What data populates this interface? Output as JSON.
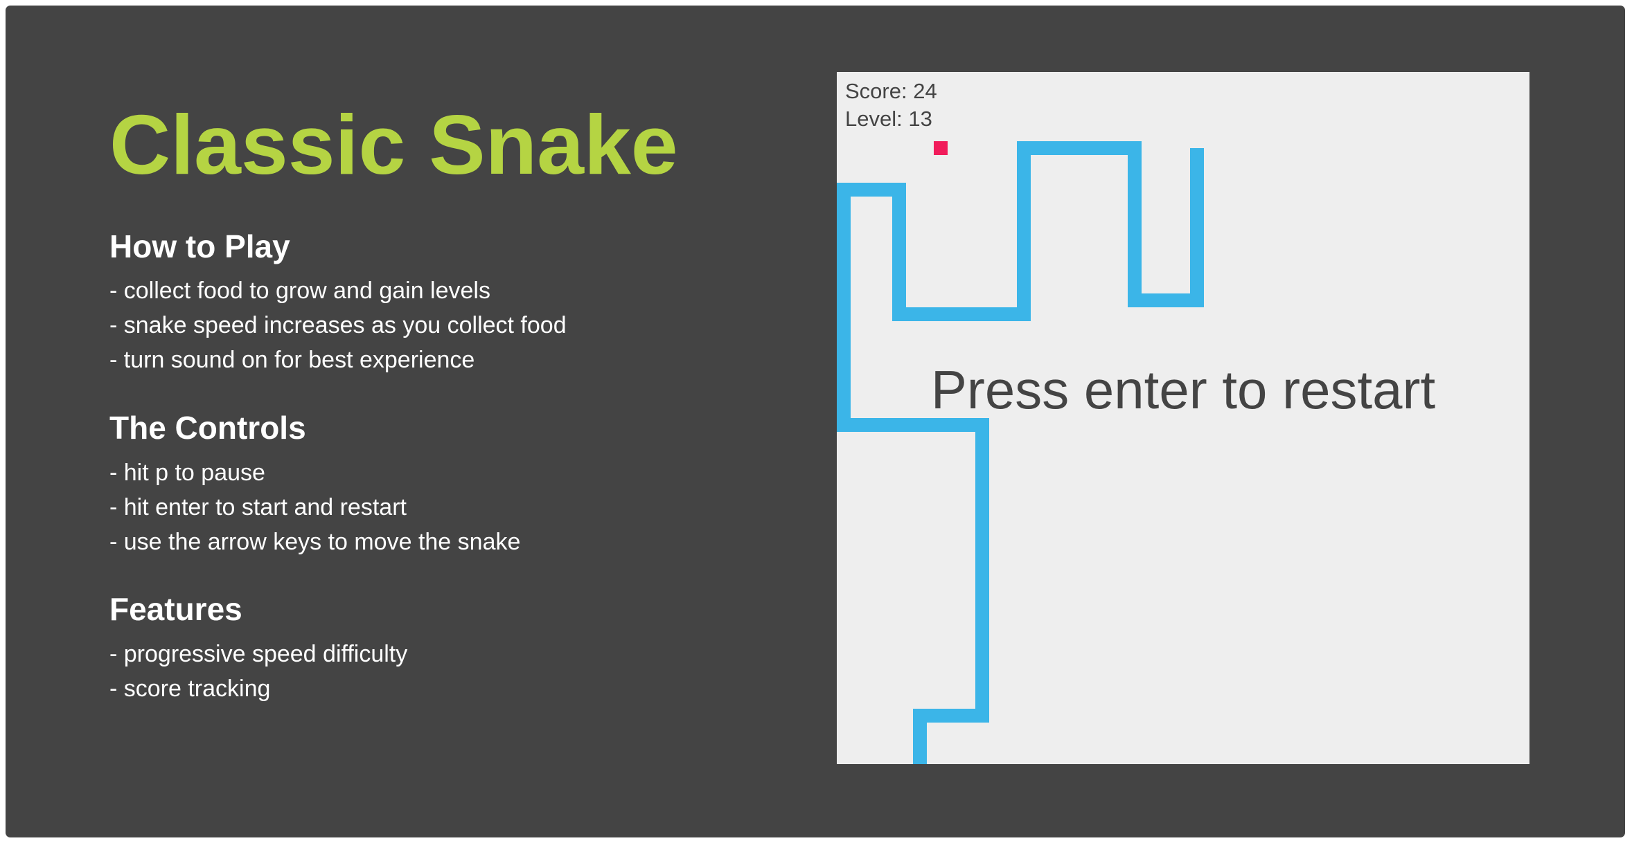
{
  "title": "Classic Snake",
  "sections": [
    {
      "heading": "How to Play",
      "items": [
        "- collect food to grow and gain levels",
        "- snake speed increases as you collect food",
        "- turn sound on for best experience"
      ]
    },
    {
      "heading": "The Controls",
      "items": [
        "- hit p to pause",
        "- hit enter to start and restart",
        "- use the arrow keys to move the snake"
      ]
    },
    {
      "heading": "Features",
      "items": [
        "- progressive speed difficulty",
        "- score tracking"
      ]
    }
  ],
  "game": {
    "score_text": "Score: 24",
    "level_text": "Level: 13",
    "message": "Press enter to restart",
    "colors": {
      "background": "#444444",
      "title": "#b5d443",
      "board": "#eeeeee",
      "snake": "#3bb5e8",
      "food": "#f11c5b",
      "text": "#444444"
    }
  }
}
